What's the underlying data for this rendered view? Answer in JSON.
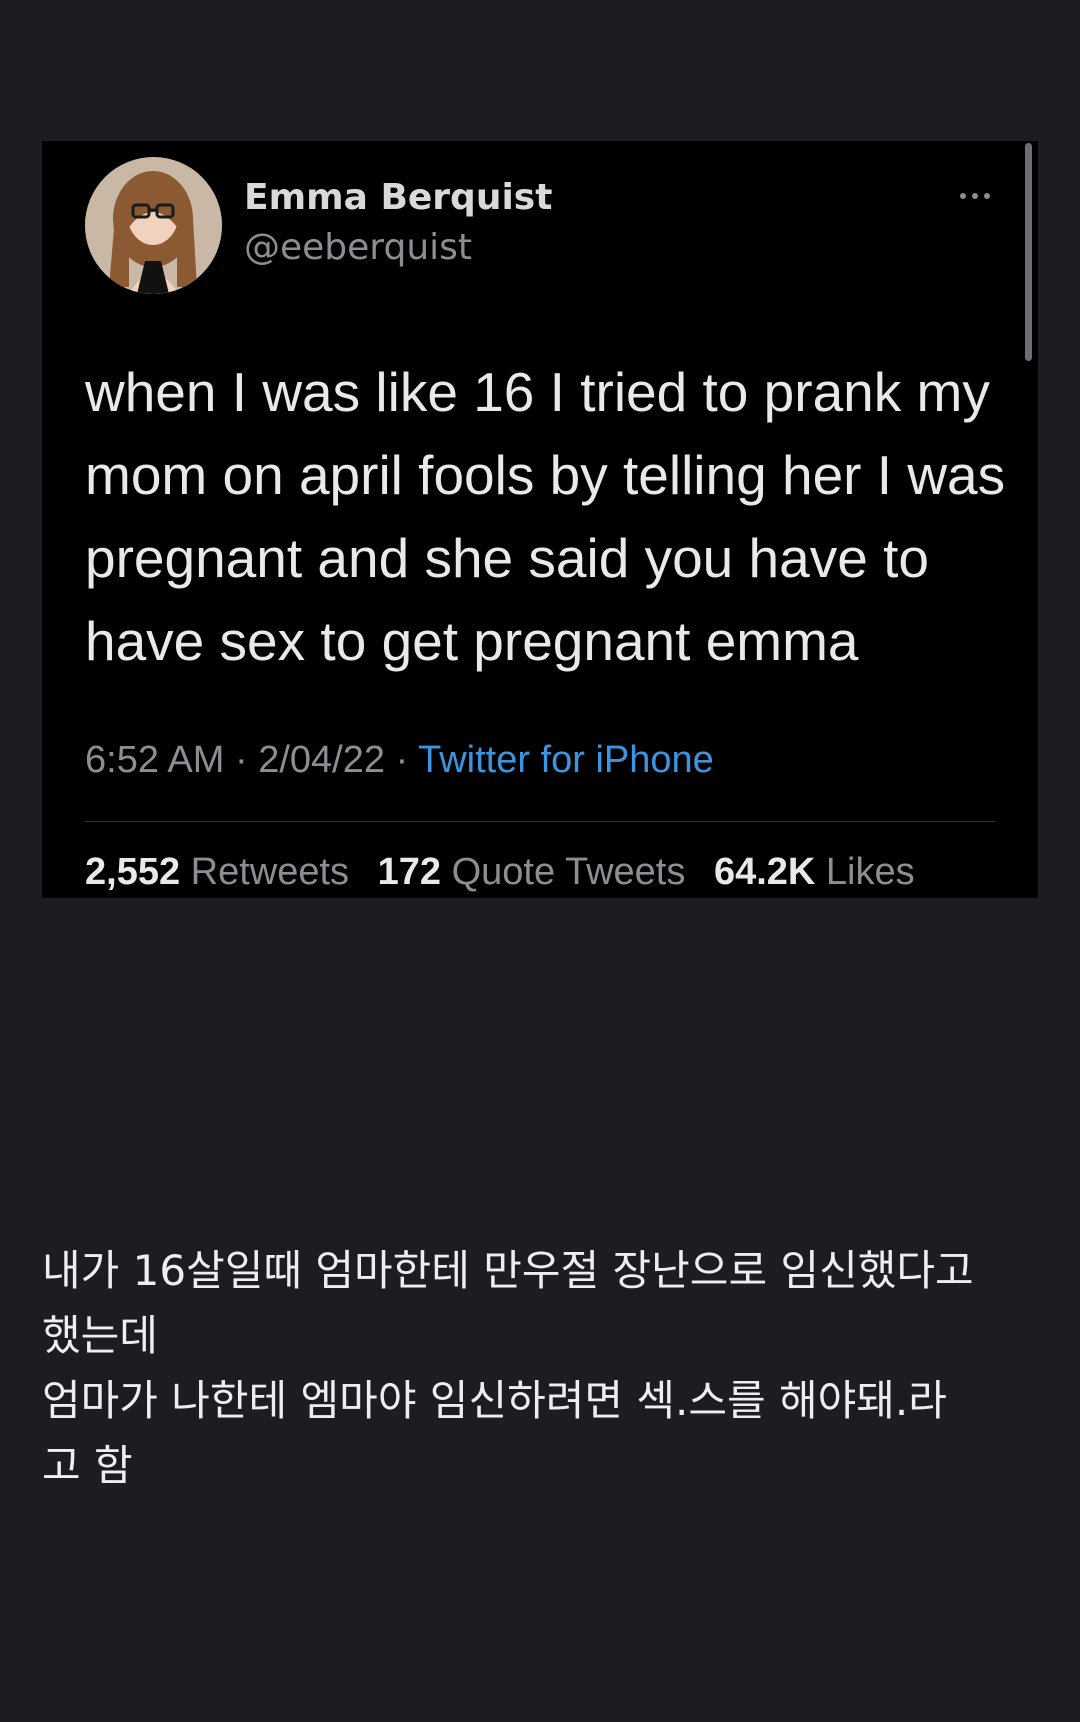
{
  "tweet": {
    "author_name": "Emma Berquist",
    "author_handle": "@eeberquist",
    "avatar_icon": "profile-photo",
    "more_icon": "ellipsis-icon",
    "text": "when I was like 16 I tried to prank my mom on april fools by telling her I was pregnant and she said you have to have sex to get pregnant emma",
    "time": "6:52 AM",
    "separator": "·",
    "date": "2/04/22",
    "source": "Twitter for iPhone",
    "stats": {
      "retweets_count": "2,552",
      "retweets_label": "Retweets",
      "quotes_count": "172",
      "quotes_label": "Quote Tweets",
      "likes_count": "64.2K",
      "likes_label": "Likes"
    }
  },
  "caption": {
    "line1": "내가 16살일때 엄마한테 만우절 장난으로 임신했다고",
    "line2": "했는데",
    "line3": "엄마가 나한테 엠마야 임신하려면 섹.스를 해야돼.라",
    "line4": "고 함"
  },
  "colors": {
    "page_background": "#1b1d22",
    "card_background": "#000000",
    "link": "#3b95e0",
    "muted_text": "#8b8f93"
  }
}
